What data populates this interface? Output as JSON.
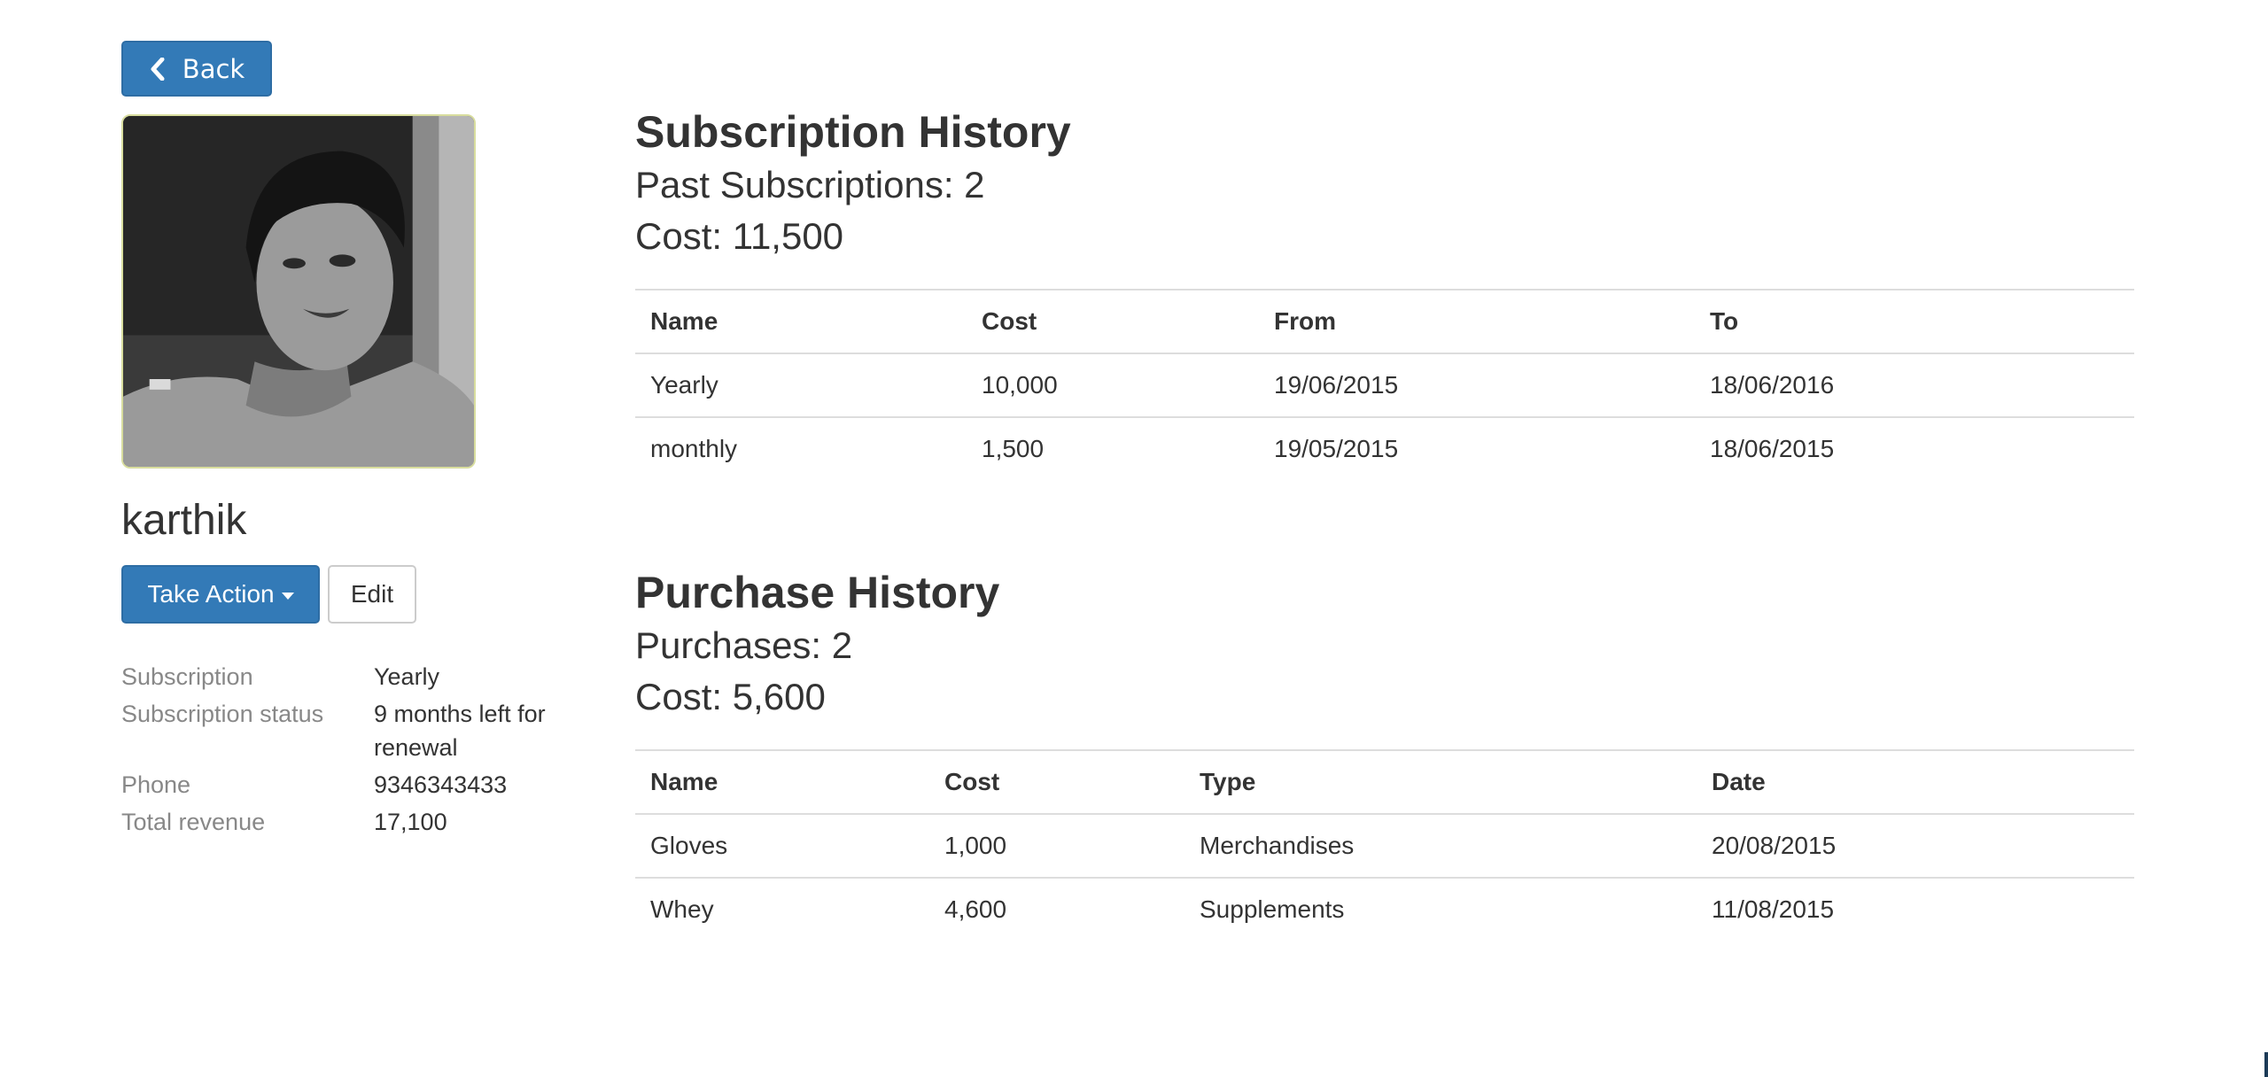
{
  "back_button": {
    "label": "Back",
    "icon": "chevron-left-icon"
  },
  "profile": {
    "name": "karthik",
    "action_label": "Take Action",
    "edit_label": "Edit",
    "details": [
      {
        "key": "Subscription",
        "value": "Yearly"
      },
      {
        "key": "Subscription status",
        "value": "9 months left for renewal"
      },
      {
        "key": "Phone",
        "value": "9346343433"
      },
      {
        "key": "Total revenue",
        "value": "17,100"
      }
    ]
  },
  "subscription_history": {
    "title": "Subscription History",
    "count_text": "Past Subscriptions: 2",
    "cost_text": "Cost: 11,500",
    "columns": [
      "Name",
      "Cost",
      "From",
      "To"
    ],
    "rows": [
      [
        "Yearly",
        "10,000",
        "19/06/2015",
        "18/06/2016"
      ],
      [
        "monthly",
        "1,500",
        "19/05/2015",
        "18/06/2015"
      ]
    ]
  },
  "purchase_history": {
    "title": "Purchase History",
    "count_text": "Purchases: 2",
    "cost_text": "Cost: 5,600",
    "columns": [
      "Name",
      "Cost",
      "Type",
      "Date"
    ],
    "rows": [
      [
        "Gloves",
        "1,000",
        "Merchandises",
        "20/08/2015"
      ],
      [
        "Whey",
        "4,600",
        "Supplements",
        "11/08/2015"
      ]
    ]
  },
  "colors": {
    "primary": "#337ab7",
    "muted": "#888888",
    "border": "#dddddd"
  }
}
